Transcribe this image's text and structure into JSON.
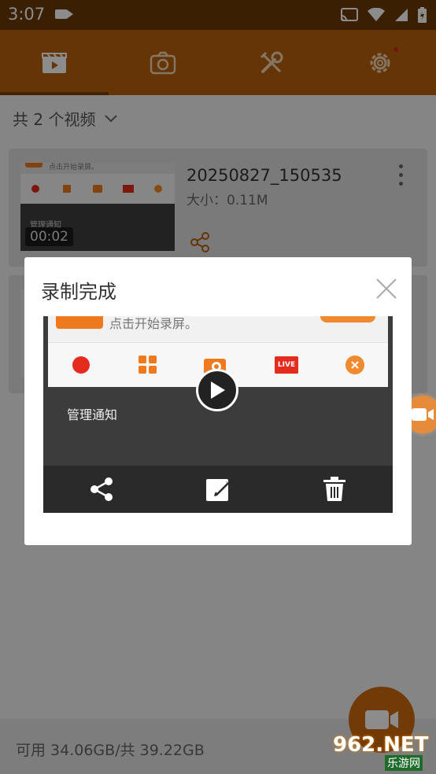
{
  "status_bar": {
    "time": "3:07"
  },
  "toolbar": {
    "tabs": [
      {
        "icon": "video-library-icon"
      },
      {
        "icon": "camera-icon"
      },
      {
        "icon": "tools-icon"
      },
      {
        "icon": "gear-icon"
      }
    ],
    "colors": {
      "toolbar": "#b8620c",
      "accent": "#ef7a1e"
    }
  },
  "list": {
    "count_label": "共 2 个视频",
    "items": [
      {
        "name": "20250827_150535",
        "size": "大小：0.11M",
        "duration": "00:02",
        "thumb_hint": "点击开始录屏。",
        "thumb_notice": "管理通知"
      }
    ]
  },
  "storage": {
    "label": "可用 34.06GB/共 39.22GB"
  },
  "dialog": {
    "title": "录制完成",
    "preview": {
      "hint_text": "点击开始录屏。",
      "notice_label": "管理通知",
      "live_badge": "LIVE"
    }
  },
  "watermark": {
    "brand": "962.NET",
    "sub": "乐游网"
  }
}
